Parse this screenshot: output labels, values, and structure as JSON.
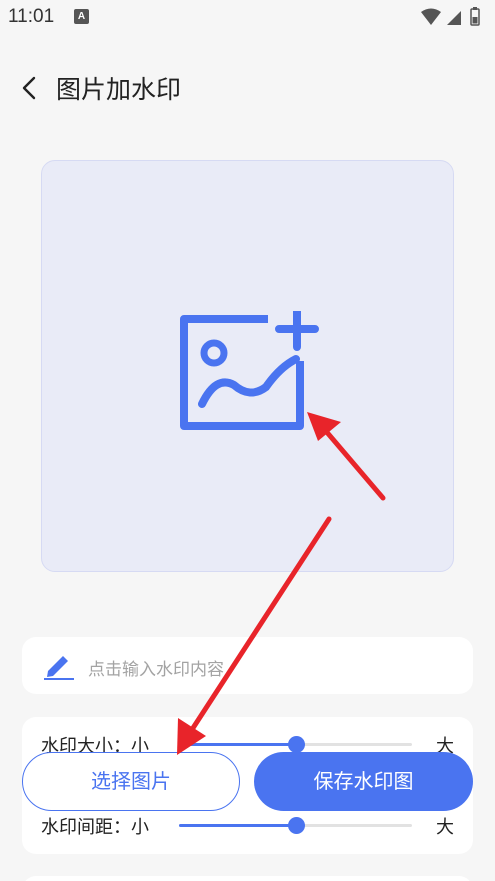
{
  "status_bar": {
    "time": "11:01",
    "notification_glyph": "A",
    "icons": [
      "wifi-icon",
      "signal-icon",
      "battery-icon"
    ]
  },
  "app_bar": {
    "title": "图片加水印",
    "back_icon": "chevron-left-icon"
  },
  "image_picker": {
    "icon": "add-image-icon"
  },
  "watermark_input": {
    "placeholder": "点击输入水印内容",
    "icon": "pen-icon"
  },
  "settings": {
    "size": {
      "label": "水印大小：小",
      "max_label": "大",
      "value": 0.5
    },
    "spacing": {
      "label": "水印间距：小",
      "max_label": "大",
      "value": 0.5
    }
  },
  "actions": {
    "select_label": "选择图片",
    "save_label": "保存水印图"
  },
  "colors": {
    "accent": "#4a74f0",
    "annotation_arrow": "#e8242a",
    "image_box_bg": "#e9ebf7"
  }
}
